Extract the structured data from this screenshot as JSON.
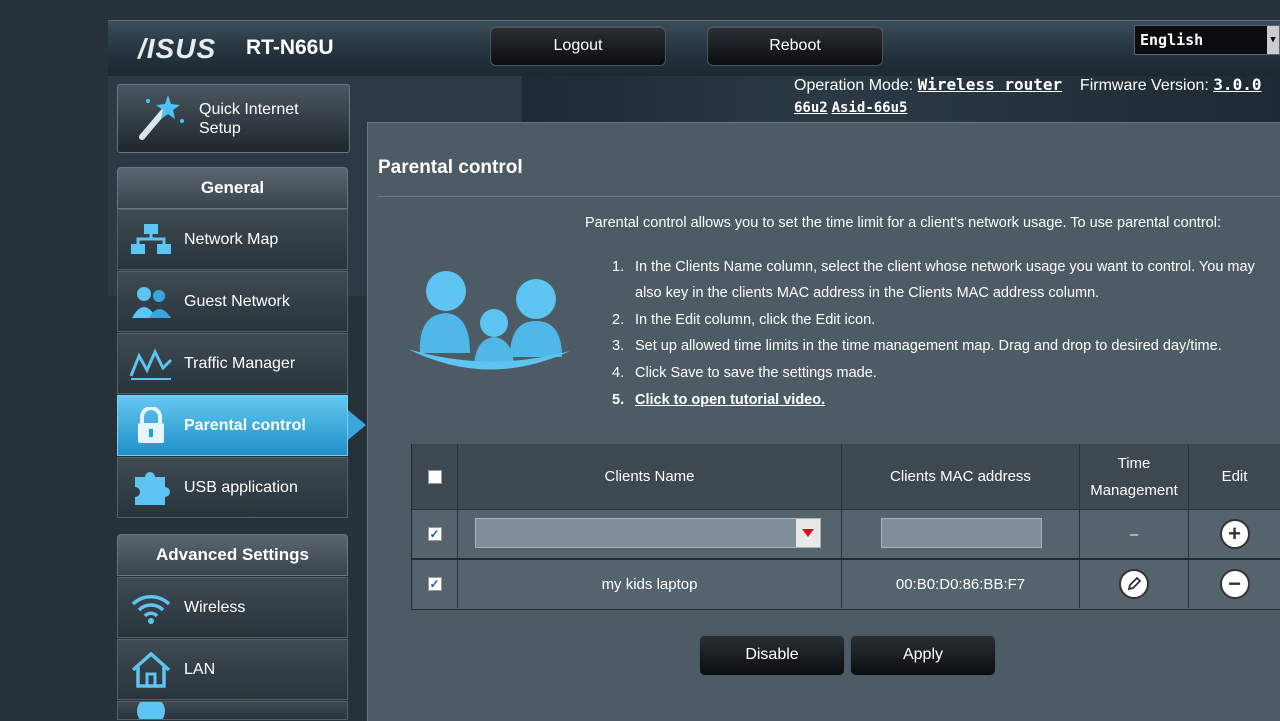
{
  "header": {
    "logo": "/ISUS",
    "model": "RT-N66U",
    "logout_label": "Logout",
    "reboot_label": "Reboot",
    "language": "English",
    "operation_mode_label": "Operation Mode:",
    "operation_mode_value": "Wireless router",
    "firmware_label": "Firmware Version:",
    "firmware_value_part1": "3.0.0",
    "firmware_value_part2": "66u2",
    "firmware_value_part3": "Asid-66u5"
  },
  "sidebar": {
    "quick_setup_line1": "Quick Internet",
    "quick_setup_line2": "Setup",
    "general_title": "General",
    "general_items": [
      {
        "label": "Network Map",
        "icon": "network-map-icon"
      },
      {
        "label": "Guest Network",
        "icon": "guest-network-icon"
      },
      {
        "label": "Traffic Manager",
        "icon": "traffic-manager-icon"
      },
      {
        "label": "Parental control",
        "icon": "lock-icon",
        "active": true
      },
      {
        "label": "USB application",
        "icon": "puzzle-icon"
      }
    ],
    "advanced_title": "Advanced Settings",
    "advanced_items": [
      {
        "label": "Wireless",
        "icon": "wifi-icon"
      },
      {
        "label": "LAN",
        "icon": "home-icon"
      }
    ]
  },
  "main": {
    "title": "Parental control",
    "intro": "Parental control allows you to set the time limit for a client's network usage. To use parental control:",
    "steps": [
      {
        "num": "1.",
        "text": "In the Clients Name column, select the client whose network usage you want to control. You may also key in the clients MAC address in the Clients MAC address column."
      },
      {
        "num": "2.",
        "text": "In the Edit column, click the Edit icon."
      },
      {
        "num": "3.",
        "text": "Set up allowed time limits in the time management map. Drag and drop to desired day/time."
      },
      {
        "num": "4.",
        "text": "Click Save to save the settings made."
      },
      {
        "num": "5.",
        "text": "Click to open tutorial video."
      }
    ],
    "table": {
      "headers": {
        "clients_name": "Clients Name",
        "mac": "Clients MAC address",
        "time_line1": "Time",
        "time_line2": "Management",
        "edit": "Edit"
      },
      "new_row": {
        "time_management": "–",
        "name_value": "",
        "mac_value": ""
      },
      "rows": [
        {
          "name": "my kids laptop",
          "mac": "00:B0:D0:86:BB:F7"
        }
      ]
    },
    "disable_label": "Disable",
    "apply_label": "Apply"
  }
}
